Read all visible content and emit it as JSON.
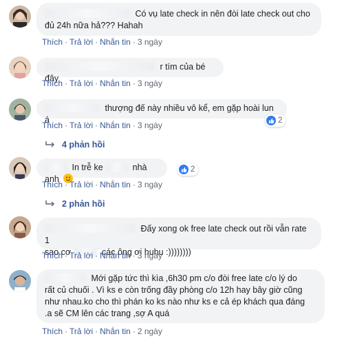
{
  "comments": [
    {
      "text": "Có vụ late check in nên đòi late check out cho đủ 24h nữa hả??? Hahah",
      "actions": {
        "like": "Thích",
        "reply": "Trả lời",
        "message": "Nhắn tin",
        "time": "3 ngày"
      }
    },
    {
      "text": "r tím của bé đây",
      "actions": {
        "like": "Thích",
        "reply": "Trả lời",
        "message": "Nhắn tin",
        "time": "3 ngày"
      }
    },
    {
      "text": "thượng đế này nhiều vô kể, em gặp hoài lun á",
      "actions": {
        "like": "Thích",
        "reply": "Trả lời",
        "message": "Nhắn tin",
        "time": "3 ngày"
      },
      "reactions": "2",
      "replies": "4 phản hồi"
    },
    {
      "text_before": "In trễ ke",
      "text_after": "nhà anh",
      "actions": {
        "like": "Thích",
        "reply": "Trả lời",
        "message": "Nhắn tin",
        "time": "3 ngày"
      },
      "reactions": "2",
      "replies": "2 phản hồi"
    },
    {
      "text_line1": "Đấy xong ok free late check out rồi vẫn rate 1",
      "text_line2_before": "sao cơ",
      "text_line2_after": "các ông ơi huhu :))))))))",
      "actions": {
        "like": "Thích",
        "reply": "Trả lời",
        "message": "Nhắn tin",
        "time": "3 ngày"
      }
    },
    {
      "text_line1": "Mới gặp tức thì kìa ,6h30 pm c/o đòi free late c/o lý do",
      "text_line2": "rất củ chuối . Vì ks e còn trống đầy phòng c/o 12h hay bây giờ cũng",
      "text_line3": "như nhau.ko cho thì phán ko ks nào như ks e cả ép khách qua đáng",
      "text_line4": ".a sẽ CM lên các trang ,sợ A quá",
      "actions": {
        "like": "Thích",
        "reply": "Trả lời",
        "message": "Nhắn tin",
        "time": "2 ngày"
      }
    }
  ],
  "colors": {
    "link": "#385898",
    "bubble": "#f2f3f5",
    "like_badge": "#2e7bf2"
  }
}
